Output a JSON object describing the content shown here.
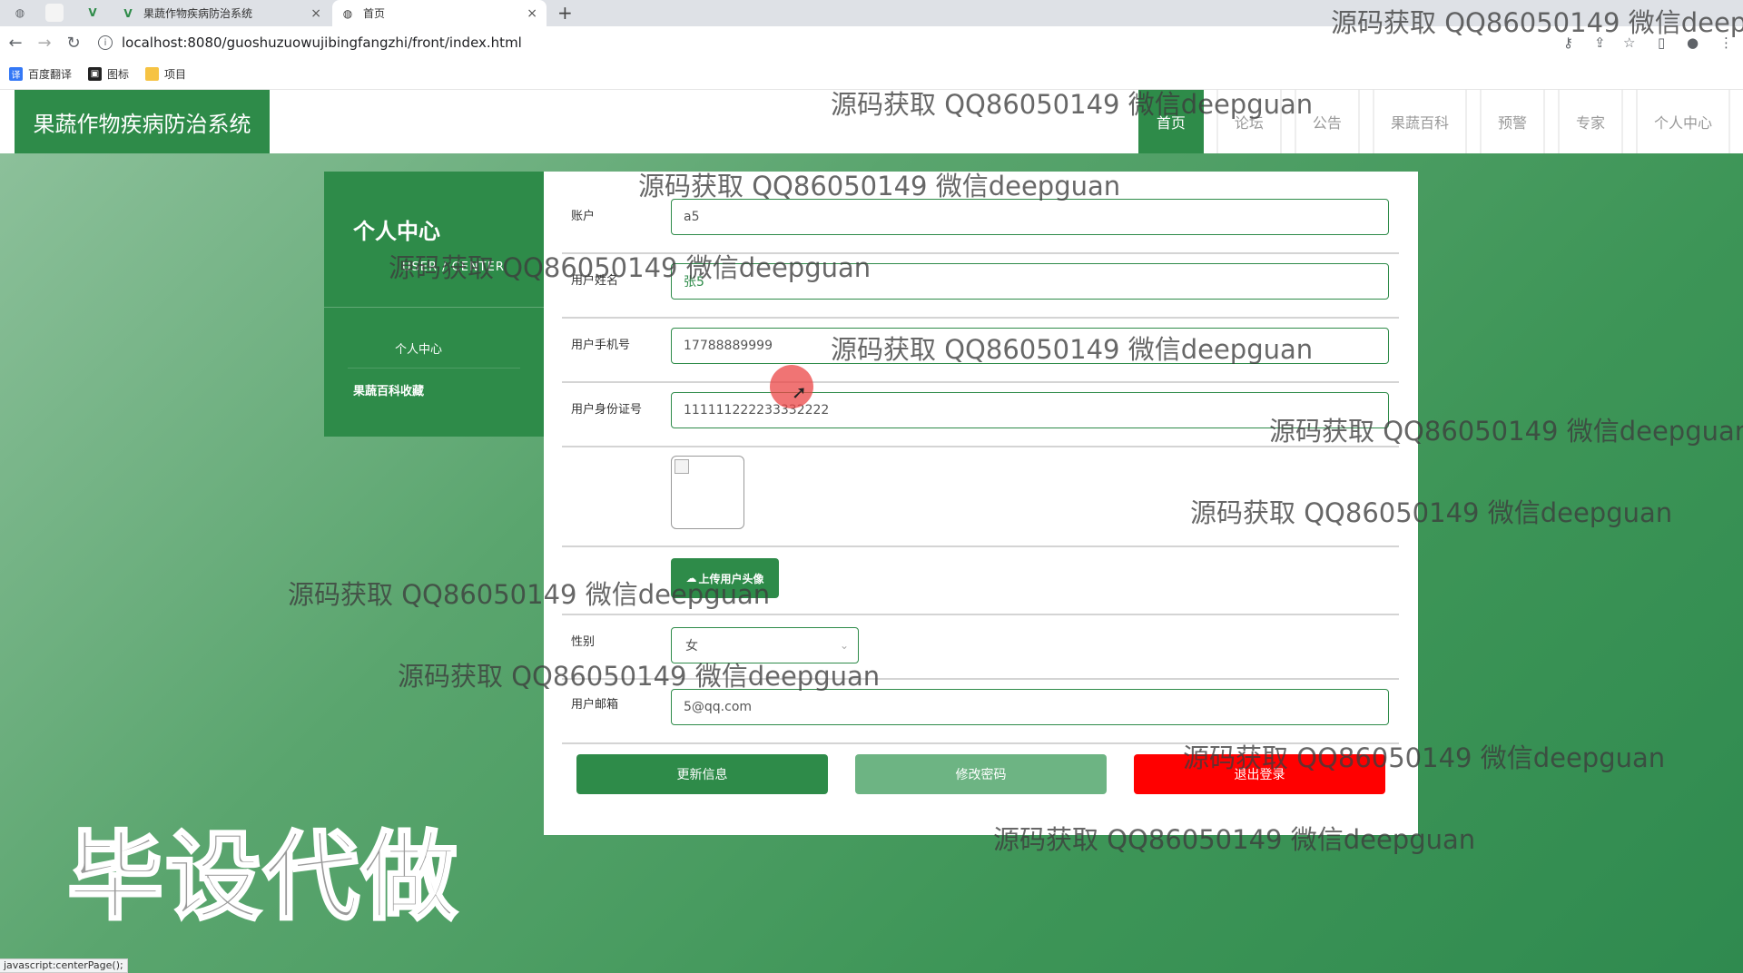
{
  "browser": {
    "tabs": [
      {
        "label": "果蔬作物疾病防治系统",
        "active": false
      },
      {
        "label": "首页",
        "active": true
      }
    ],
    "url": "localhost:8080/guoshuzuowujibingfangzhi/front/index.html",
    "bookmarks": [
      "百度翻译",
      "图标",
      "项目"
    ],
    "status_text": "javascript:centerPage();"
  },
  "header": {
    "logo": "果蔬作物疾病防治系统",
    "nav": [
      {
        "label": "首页",
        "active": true
      },
      {
        "label": "论坛",
        "active": false
      },
      {
        "label": "公告",
        "active": false
      },
      {
        "label": "果蔬百科",
        "active": false
      },
      {
        "label": "预警",
        "active": false
      },
      {
        "label": "专家",
        "active": false
      },
      {
        "label": "个人中心",
        "active": false
      }
    ]
  },
  "sidebar": {
    "title": "个人中心",
    "subtitle": "USER / CENTER",
    "items": [
      "个人中心",
      "果蔬百科收藏"
    ]
  },
  "form": {
    "account_label": "账户",
    "account_value": "a5",
    "name_label": "用户姓名",
    "name_value": "张5",
    "phone_label": "用户手机号",
    "phone_value": "17788889999",
    "idcard_label": "用户身份证号",
    "idcard_value": "111111222233332222",
    "upload_label": "上传用户头像",
    "gender_label": "性别",
    "gender_value": "女",
    "email_label": "用户邮箱",
    "email_value": "5@qq.com"
  },
  "buttons": {
    "update": "更新信息",
    "change_password": "修改密码",
    "logout": "退出登录"
  },
  "watermarks": {
    "text": "源码获取 QQ86050149 微信deepguan",
    "big": "毕设代做"
  },
  "colors": {
    "primary": "#2e8b49",
    "secondary": "#6db483",
    "danger": "#ff0000"
  }
}
